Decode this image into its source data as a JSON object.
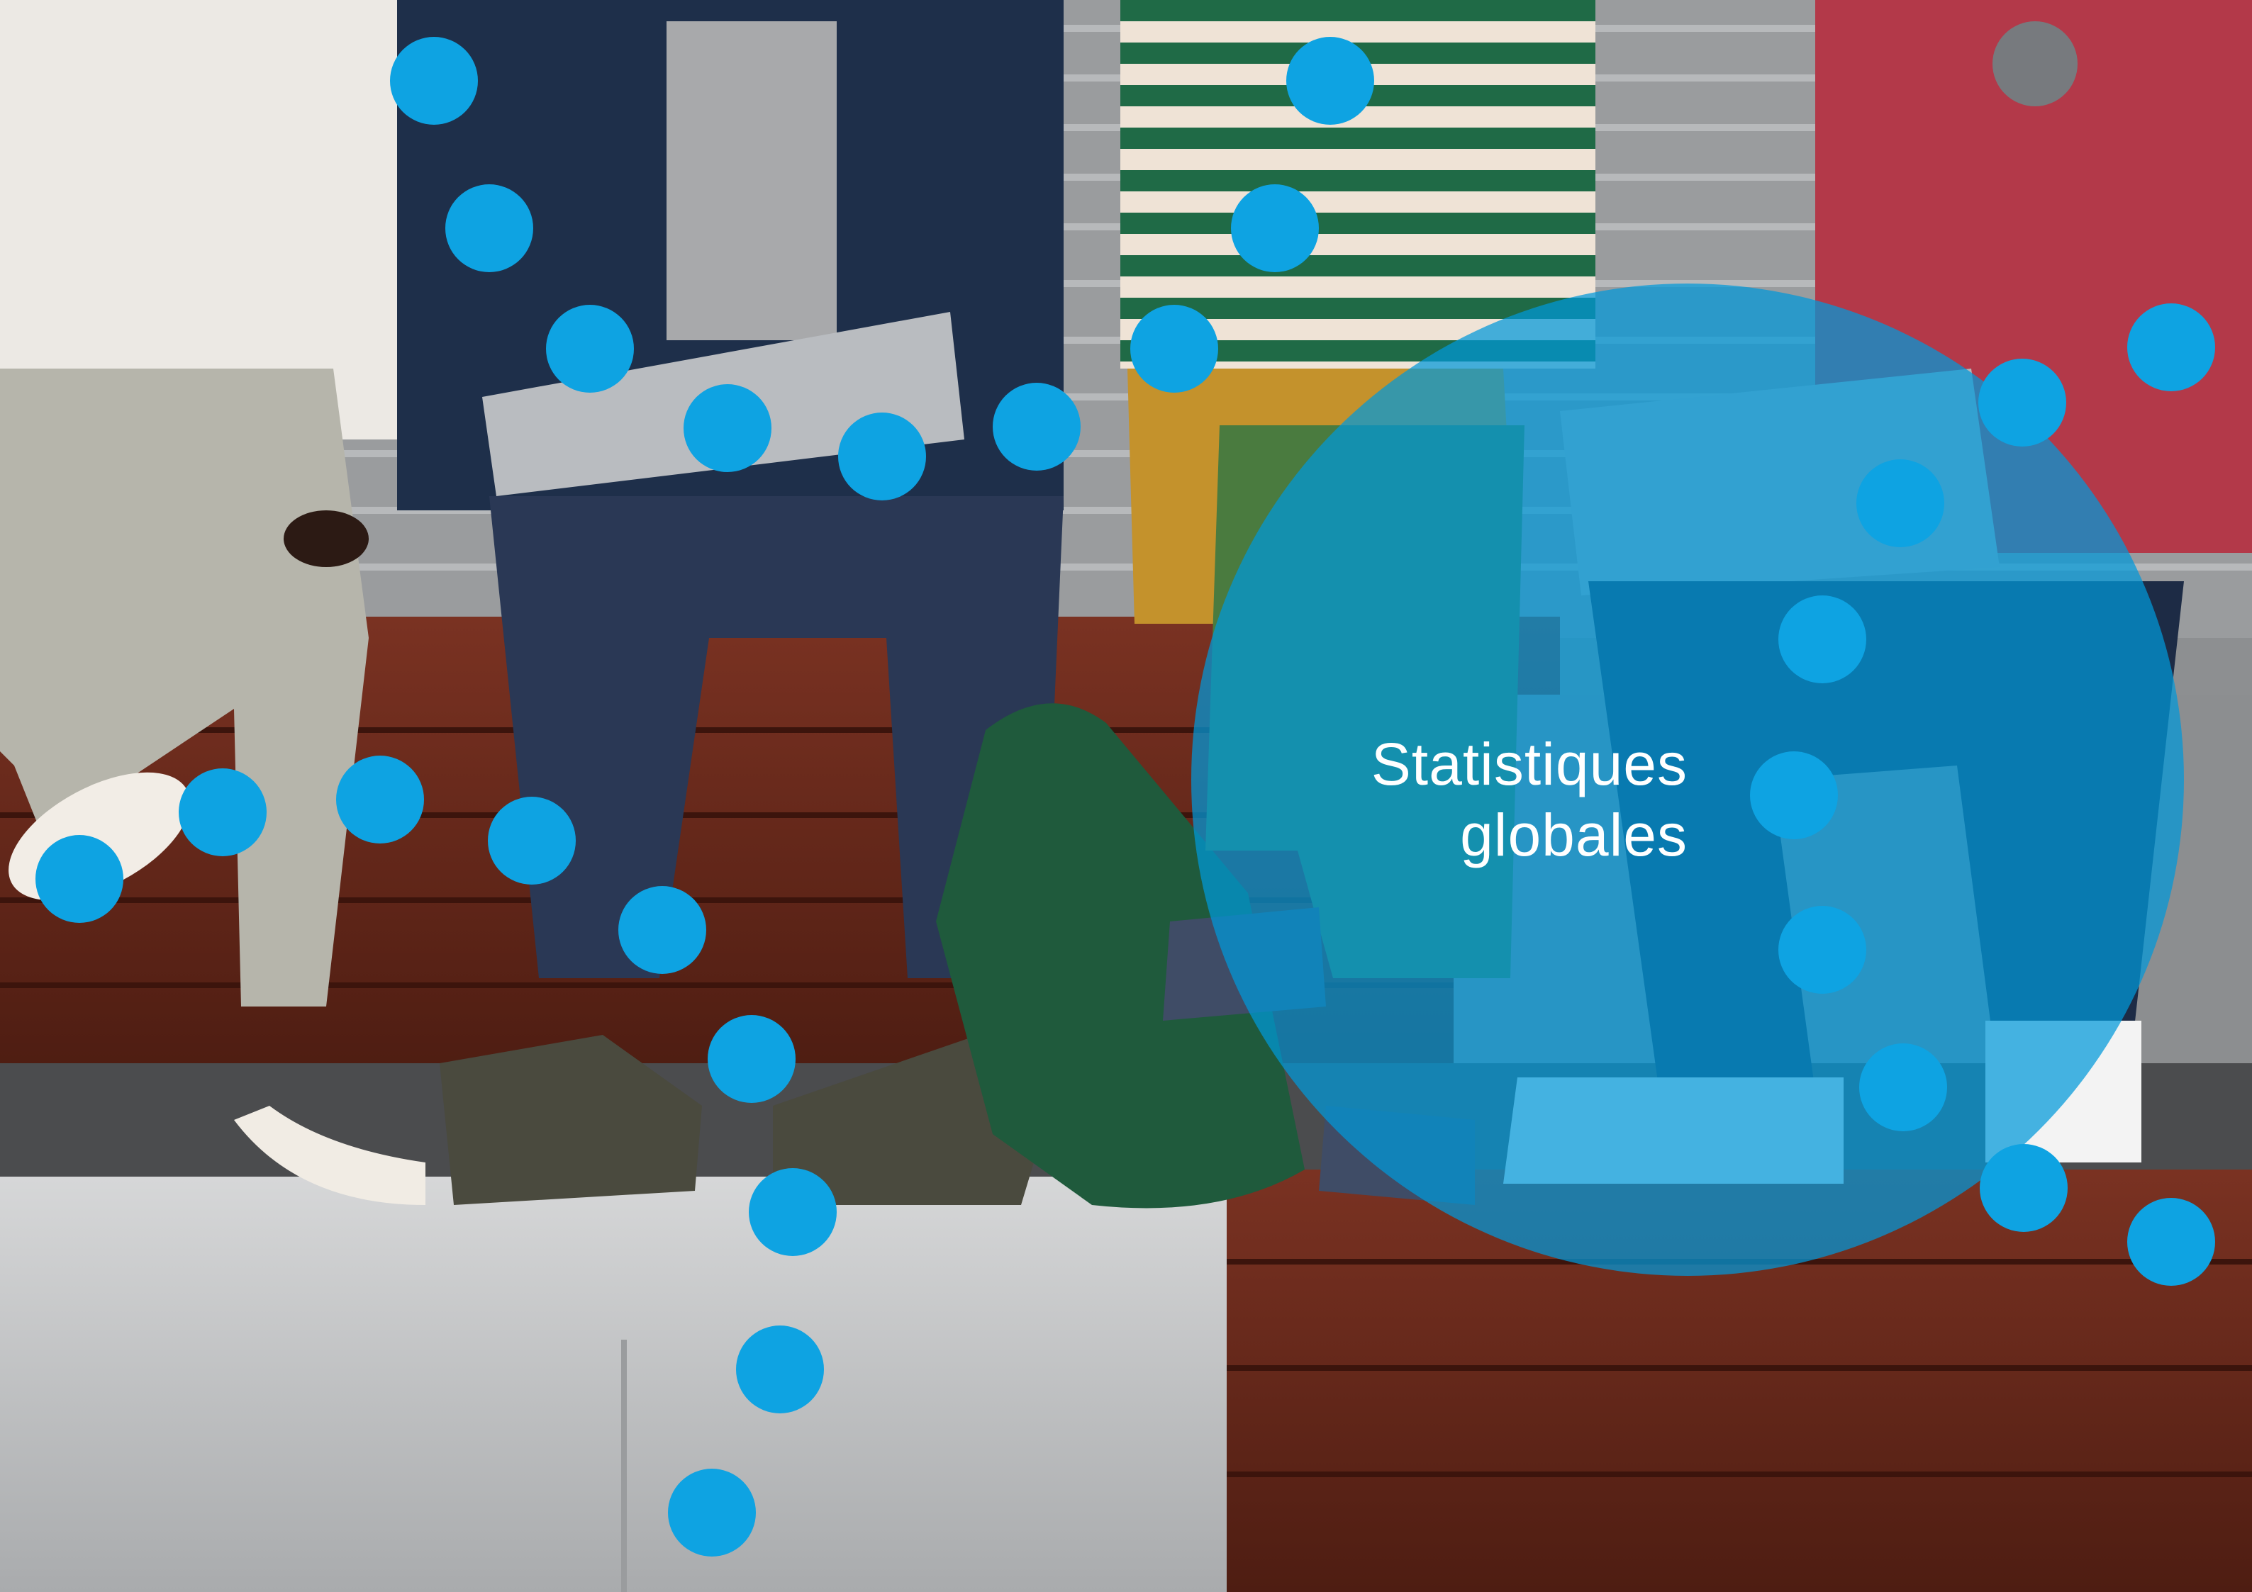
{
  "title": {
    "line1": "Statistiques",
    "line2": "globales"
  },
  "colors": {
    "dot": "#0ea3e2",
    "circle_overlay": "#0098d9",
    "wood": "#6b2a1c",
    "concrete": "#c9cacb"
  }
}
